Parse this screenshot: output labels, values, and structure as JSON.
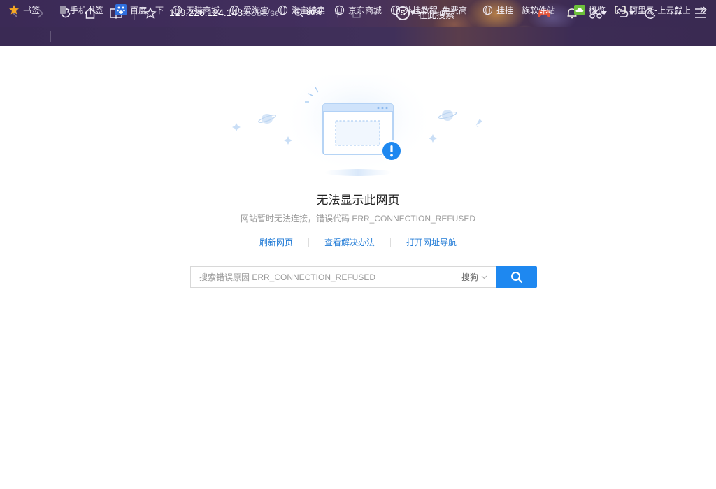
{
  "toolbar": {
    "url_host": "129.226.124.143",
    "url_rest": ":8888/se",
    "zoom": "80%",
    "search_placeholder": "在此搜索",
    "search_engine_letter": "S"
  },
  "bookmarks": [
    {
      "label": "书签",
      "icon": "star-icon"
    },
    {
      "label": "手机书签",
      "icon": "phone-icon"
    },
    {
      "label": "百度一下",
      "icon": "baidu-icon"
    },
    {
      "label": "天猫商城",
      "icon": "globe-icon"
    },
    {
      "label": "爱淘宝",
      "icon": "globe-icon"
    },
    {
      "label": "淘宝特卖",
      "icon": "globe-icon"
    },
    {
      "label": "京东商城",
      "icon": "globe-icon"
    },
    {
      "label": "外挂教程_免费高",
      "icon": "globe-icon"
    },
    {
      "label": "挂挂一族软件站",
      "icon": "globe-icon"
    },
    {
      "label": "概览",
      "icon": "cloud-icon"
    },
    {
      "label": "阿里云-上云就上",
      "icon": "aliyun-icon"
    }
  ],
  "error": {
    "title": "无法显示此网页",
    "description": "网站暂时无法连接，错误代码 ERR_CONNECTION_REFUSED",
    "links": [
      "刷新网页",
      "查看解决办法",
      "打开网址导航"
    ],
    "search_placeholder": "搜索错误原因 ERR_CONNECTION_REFUSED",
    "search_engine": "搜狗"
  },
  "colors": {
    "accent": "#1e88f0",
    "link": "#1f7ad6",
    "chrome_bg": "#3b2a56"
  }
}
